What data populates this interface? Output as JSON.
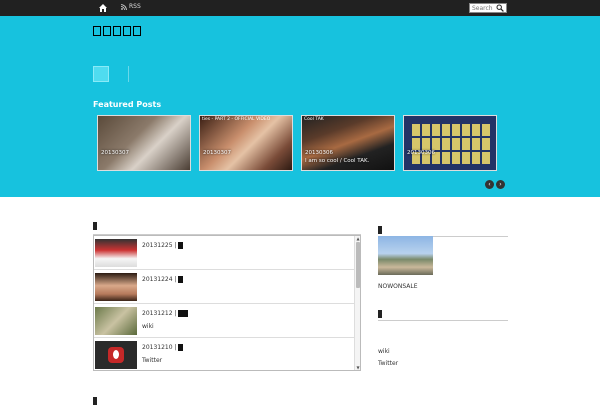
{
  "topbar": {
    "rss_label": "RSS",
    "search_placeholder": "Search"
  },
  "hero": {
    "featured_title": "Featured Posts",
    "posts": [
      {
        "date": "20130307",
        "caption": "",
        "top": ""
      },
      {
        "date": "20130307",
        "caption": "",
        "top": "ties - PART 2 - OFFICIAL VIDEO"
      },
      {
        "date": "20130306",
        "caption": "I am so cool / Cool TAK.",
        "top": "Cool TAK"
      },
      {
        "date": "20130306",
        "caption": "",
        "top": ""
      }
    ]
  },
  "main": {
    "list": [
      {
        "date": "20131225 |",
        "label": ""
      },
      {
        "date": "20131224 |",
        "label": ""
      },
      {
        "date": "20131212 |",
        "label": "wiki"
      },
      {
        "date": "20131210 |",
        "label": "Twitter"
      }
    ]
  },
  "sidebar": {
    "caption": "NOWONSALE",
    "links": [
      "wiki",
      "Twitter"
    ]
  },
  "colors": {
    "hero_bg": "#17c2de",
    "topbar_bg": "#212121"
  }
}
